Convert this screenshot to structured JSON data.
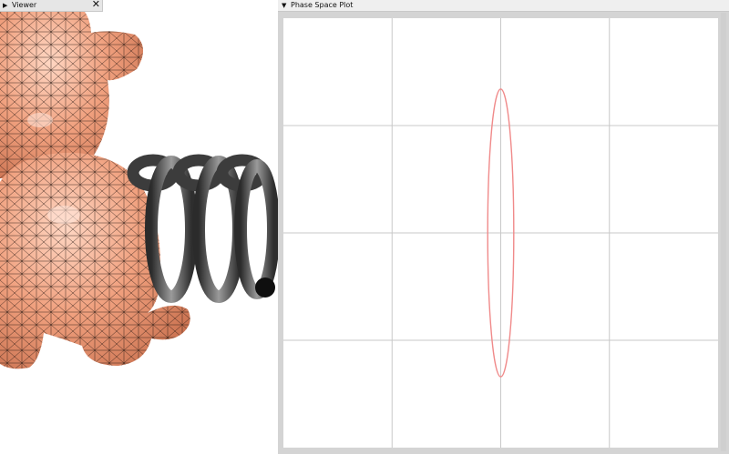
{
  "viewer": {
    "title": "Viewer",
    "close_glyph": "✕",
    "collapse_glyph": "▶",
    "close_icon": "close-icon",
    "collapse_icon": "collapse-arrow-icon",
    "mesh_color": "#f0a07e",
    "spring_color": "#4a4a4a"
  },
  "plot": {
    "title": "Phase Space Plot",
    "collapse_glyph": "▼",
    "collapse_icon": "collapse-arrow-icon",
    "grid_color": "#c8c8c8",
    "trajectory_color": "#f08a8a"
  },
  "chart_data": {
    "type": "line",
    "title": "",
    "xlabel": "",
    "ylabel": "",
    "xlim": [
      -1,
      1
    ],
    "ylim": [
      -1,
      1
    ],
    "grid": true,
    "grid_divisions": 4,
    "series": [
      {
        "shape": "ellipse",
        "center": [
          0,
          0
        ],
        "x_semi_axis": 0.06,
        "y_semi_axis": 0.67
      }
    ]
  }
}
